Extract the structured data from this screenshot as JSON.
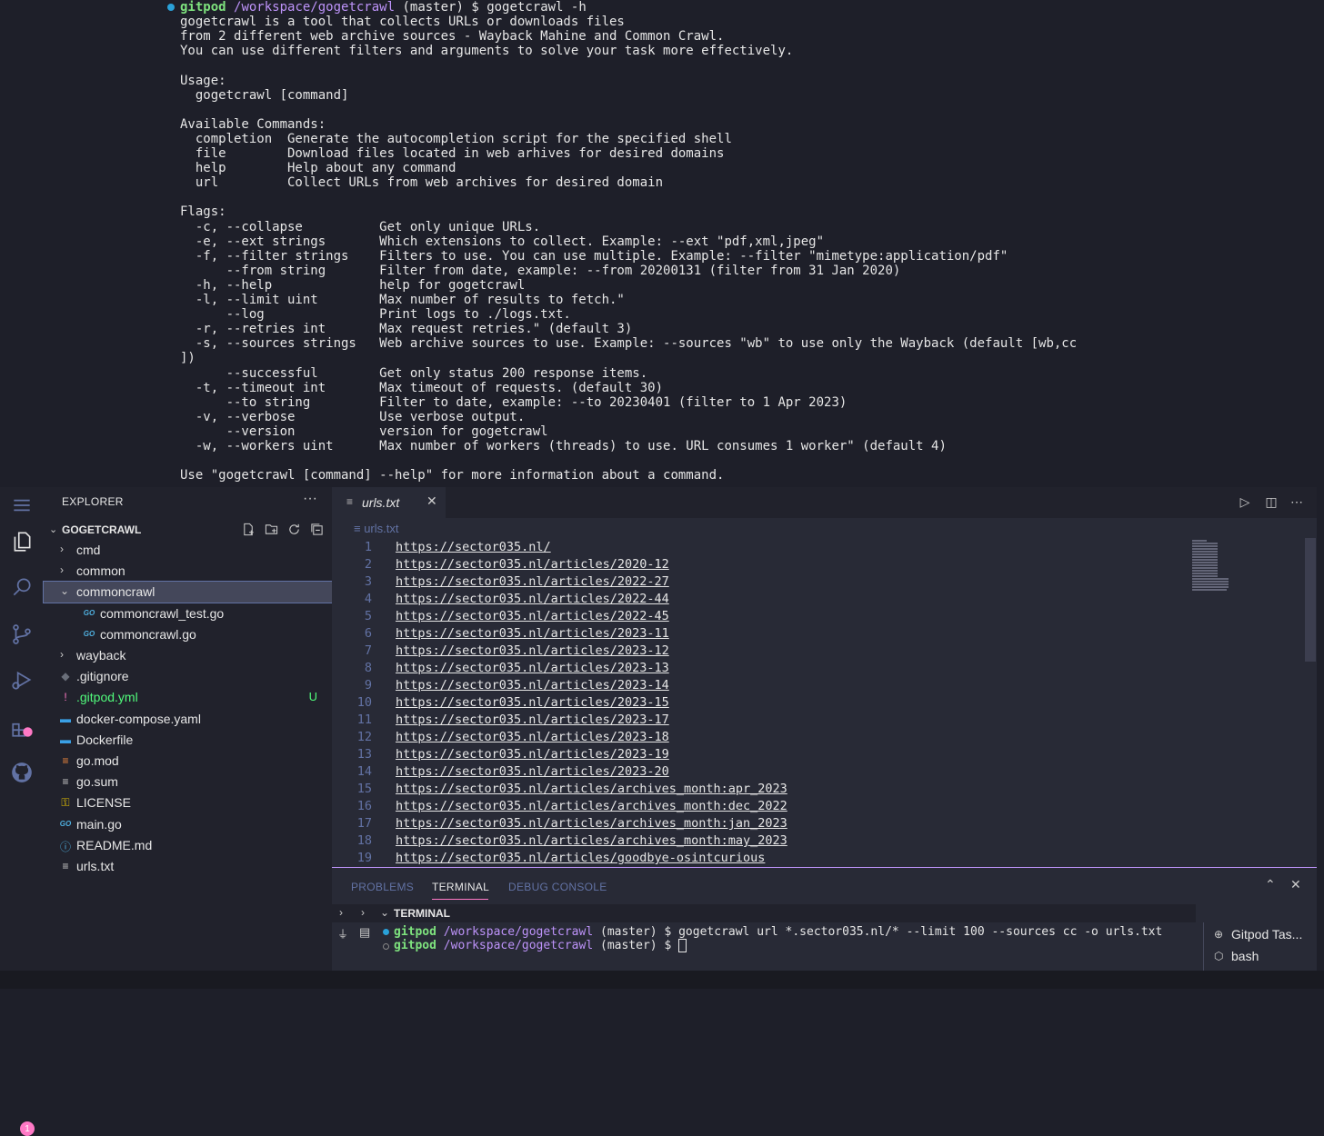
{
  "top_terminal": {
    "prompt": {
      "user": "gitpod",
      "path": "/workspace/gogetcrawl",
      "branch": "(master) $",
      "command": "gogetcrawl -h"
    },
    "lines": [
      "gogetcrawl is a tool that collects URLs or downloads files",
      "from 2 different web archive sources - Wayback Mahine and Common Crawl.",
      "You can use different filters and arguments to solve your task more effectively.",
      "",
      "Usage:",
      "  gogetcrawl [command]",
      "",
      "Available Commands:",
      "  completion  Generate the autocompletion script for the specified shell",
      "  file        Download files located in web arhives for desired domains",
      "  help        Help about any command",
      "  url         Collect URLs from web archives for desired domain",
      "",
      "Flags:",
      "  -c, --collapse          Get only unique URLs.",
      "  -e, --ext strings       Which extensions to collect. Example: --ext \"pdf,xml,jpeg\"",
      "  -f, --filter strings    Filters to use. You can use multiple. Example: --filter \"mimetype:application/pdf\"",
      "      --from string       Filter from date, example: --from 20200131 (filter from 31 Jan 2020)",
      "  -h, --help              help for gogetcrawl",
      "  -l, --limit uint        Max number of results to fetch.\"",
      "      --log               Print logs to ./logs.txt.",
      "  -r, --retries int       Max request retries.\" (default 3)",
      "  -s, --sources strings   Web archive sources to use. Example: --sources \"wb\" to use only the Wayback (default [wb,cc",
      "])",
      "      --successful        Get only status 200 response items.",
      "  -t, --timeout int       Max timeout of requests. (default 30)",
      "      --to string         Filter to date, example: --to 20230401 (filter to 1 Apr 2023)",
      "  -v, --verbose           Use verbose output.",
      "      --version           version for gogetcrawl",
      "  -w, --workers uint      Max number of workers (threads) to use. URL consumes 1 worker\" (default 4)",
      "",
      "Use \"gogetcrawl [command] --help\" for more information about a command."
    ]
  },
  "sidebar": {
    "title": "EXPLORER",
    "more": "···",
    "section_title": "GOGETCRAWL",
    "items": [
      {
        "label": "cmd",
        "kind": "folder"
      },
      {
        "label": "common",
        "kind": "folder"
      },
      {
        "label": "commoncrawl",
        "kind": "folder-open"
      },
      {
        "label": "commoncrawl_test.go",
        "kind": "go"
      },
      {
        "label": "commoncrawl.go",
        "kind": "go"
      },
      {
        "label": "wayback",
        "kind": "folder"
      },
      {
        "label": ".gitignore",
        "kind": "git"
      },
      {
        "label": ".gitpod.yml",
        "kind": "yml",
        "status": "U"
      },
      {
        "label": "docker-compose.yaml",
        "kind": "docker"
      },
      {
        "label": "Dockerfile",
        "kind": "docker"
      },
      {
        "label": "go.mod",
        "kind": "rss"
      },
      {
        "label": "go.sum",
        "kind": "lines"
      },
      {
        "label": "LICENSE",
        "kind": "license"
      },
      {
        "label": "main.go",
        "kind": "go"
      },
      {
        "label": "README.md",
        "kind": "info"
      },
      {
        "label": "urls.txt",
        "kind": "lines"
      }
    ]
  },
  "activity_bar": {
    "icons": [
      "menu-icon",
      "files-icon",
      "search-icon",
      "source-control-icon",
      "run-debug-icon",
      "extensions-icon",
      "github-icon"
    ],
    "scm_badge": "1"
  },
  "editor": {
    "tab_label": "urls.txt",
    "breadcrumb": "urls.txt",
    "lines": [
      "https://sector035.nl/",
      "https://sector035.nl/articles/2020-12",
      "https://sector035.nl/articles/2022-27",
      "https://sector035.nl/articles/2022-44",
      "https://sector035.nl/articles/2022-45",
      "https://sector035.nl/articles/2023-11",
      "https://sector035.nl/articles/2023-12",
      "https://sector035.nl/articles/2023-13",
      "https://sector035.nl/articles/2023-14",
      "https://sector035.nl/articles/2023-15",
      "https://sector035.nl/articles/2023-17",
      "https://sector035.nl/articles/2023-18",
      "https://sector035.nl/articles/2023-19",
      "https://sector035.nl/articles/2023-20",
      "https://sector035.nl/articles/archives_month:apr_2023",
      "https://sector035.nl/articles/archives_month:dec_2022",
      "https://sector035.nl/articles/archives_month:jan_2023",
      "https://sector035.nl/articles/archives_month:may_2023",
      "https://sector035.nl/articles/goodbye-osintcurious"
    ]
  },
  "panel": {
    "tabs": [
      "PROBLEMS",
      "TERMINAL",
      "DEBUG CONSOLE"
    ],
    "active_tab": "TERMINAL",
    "terminal_title": "TERMINAL",
    "line1": {
      "user": "gitpod",
      "path": "/workspace/gogetcrawl",
      "branch": "(master) $",
      "command": "gogetcrawl url *.sector035.nl/* --limit 100 --sources cc -o urls.txt"
    },
    "line2": {
      "user": "gitpod",
      "path": "/workspace/gogetcrawl",
      "branch": "(master) $"
    },
    "terminal_list": [
      "Gitpod Tas...",
      "bash"
    ]
  },
  "colors": {
    "accent": "#bd93f9",
    "pink": "#ff79c6",
    "green": "#50fa7b",
    "prompt_green": "#7ee27e",
    "comment": "#6272a4"
  }
}
